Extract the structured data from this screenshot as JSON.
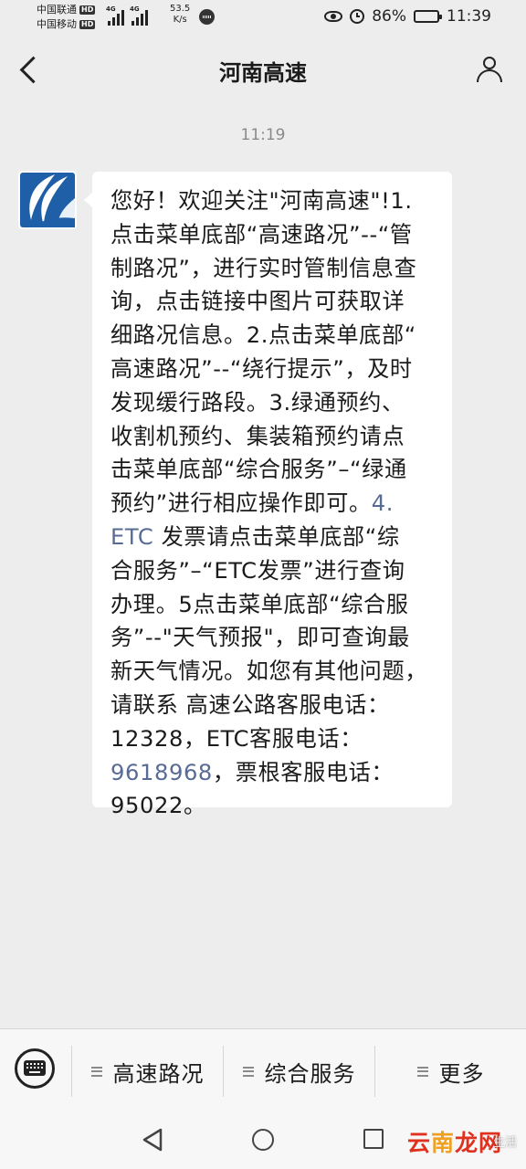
{
  "status_bar": {
    "carrier_1": "中国联通",
    "carrier_2": "中国移动",
    "hd_badge": "HD",
    "network_1": "4G",
    "network_2": "4G",
    "net_speed_value": "53.5",
    "net_speed_unit": "K/s",
    "battery_percent": "86%",
    "battery_level": 0.86,
    "time": "11:39"
  },
  "header": {
    "title": "河南高速"
  },
  "chat": {
    "timestamp": "11:19",
    "message_lines": [
      "您好！欢迎关注\"河南高速\"!1.",
      "点击菜单底部“高速路况”--“管",
      "制路况”，进行实时管制信息查",
      "询，点击链接中图片可获取详",
      "细路况信息。2.点击菜单底部“",
      "高速路况”--“绕行提示”，及时",
      "发现缓行路段。3.绿通预约、",
      "收割机预约、集装箱预约请点",
      "击菜单底部“综合服务”–“绿通",
      "预约”进行相应操作即可。",
      "ETC",
      " 发票请点击菜单底部“综",
      "合服务”–“ETC发票”进行查询",
      "办理。5点击菜单底部“综合服",
      "务”--\"天气预报\"，即可查询最",
      "新天气情况。如您有其他问题，",
      "请联系 高速公路客服电话：",
      "12328，ETC客服电话：",
      "9618968",
      "，票根客服电话：",
      "95022。"
    ],
    "link_1": "4.",
    "avatar_colors": {
      "primary": "#1f5fa8",
      "light": "#ffffff"
    }
  },
  "menu": {
    "items": [
      {
        "label": "高速路况"
      },
      {
        "label": "综合服务"
      },
      {
        "label": "更多"
      }
    ]
  },
  "watermark": {
    "logo_text": [
      "云",
      "南",
      "龙",
      "网"
    ],
    "small_text": "生活"
  },
  "colors": {
    "background": "#ededed",
    "bubble": "#ffffff",
    "link": "#576b95",
    "menu_bg": "#f7f7f7"
  }
}
